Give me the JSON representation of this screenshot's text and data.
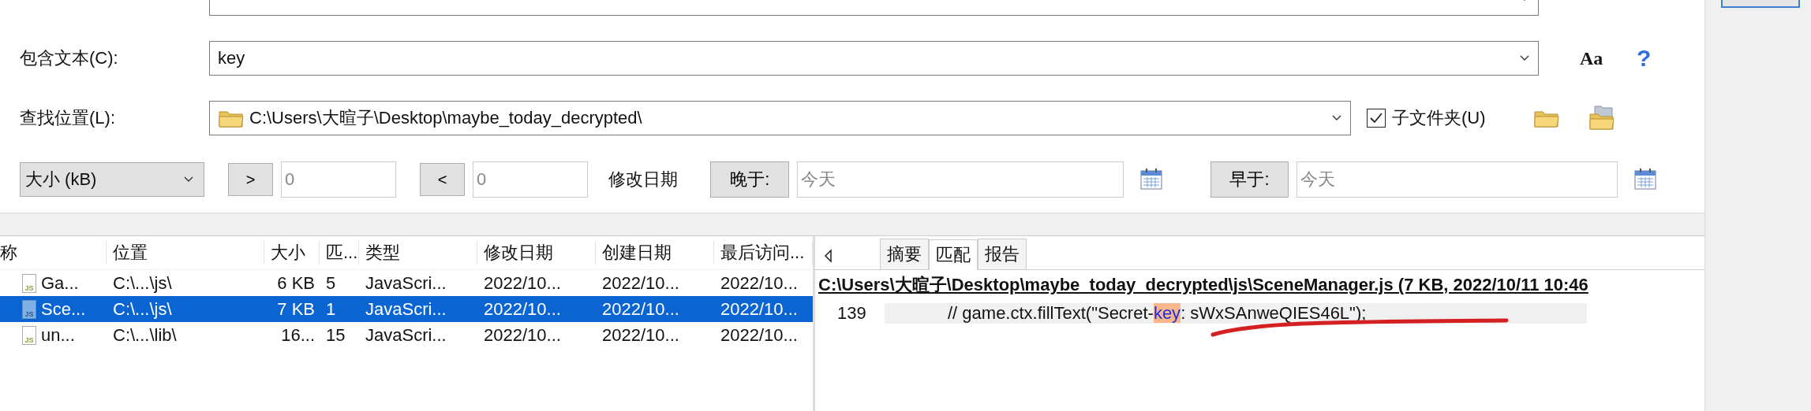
{
  "containing_text": {
    "label": "包含文本(C):",
    "value": "key",
    "case_toggle": "Aa",
    "help": "?"
  },
  "look_in": {
    "label": "查找位置(L):",
    "value": "C:\\Users\\大暄子\\Desktop\\maybe_today_decrypted\\",
    "subfolders": {
      "label": "子文件夹(U)",
      "checked": true
    }
  },
  "filters": {
    "size_unit": "大小 (kB)",
    "greater_than": {
      "label": ">",
      "placeholder": "0"
    },
    "less_than": {
      "label": "<",
      "placeholder": "0"
    },
    "date_label": "修改日期",
    "after": {
      "label": "晚于:",
      "placeholder": "今天"
    },
    "before": {
      "label": "早于:",
      "placeholder": "今天"
    }
  },
  "results": {
    "columns": [
      "称",
      "位置",
      "大小",
      "匹...",
      "类型",
      "修改日期",
      "创建日期",
      "最后访问..."
    ],
    "rows": [
      {
        "badge": "JS",
        "selected": false,
        "cells": [
          "Ga...",
          "C:\\...\\js\\",
          "6 KB",
          "5",
          "JavaScri...",
          "2022/10...",
          "2022/10...",
          "2022/10..."
        ]
      },
      {
        "badge": "JS",
        "selected": true,
        "cells": [
          "Sce...",
          "C:\\...\\js\\",
          "7 KB",
          "1",
          "JavaScri...",
          "2022/10...",
          "2022/10...",
          "2022/10..."
        ]
      },
      {
        "badge": "JS",
        "selected": false,
        "cells": [
          "un...",
          "C:\\...\\lib\\",
          "16...",
          "15",
          "JavaScri...",
          "2022/10...",
          "2022/10...",
          "2022/10..."
        ]
      }
    ]
  },
  "preview": {
    "tabs": [
      {
        "label": "摘要",
        "selected": false
      },
      {
        "label": "匹配",
        "selected": true
      },
      {
        "label": "报告",
        "selected": false
      }
    ],
    "file_header": "C:\\Users\\大暄子\\Desktop\\maybe_today_decrypted\\js\\SceneManager.js   (7 KB,  2022/10/11 10:46",
    "lines": [
      {
        "number": "139",
        "before": "// game.ctx.fillText(\"Secret-",
        "match": "key",
        "after": ": sWxSAnweQIES46L\");"
      }
    ]
  }
}
